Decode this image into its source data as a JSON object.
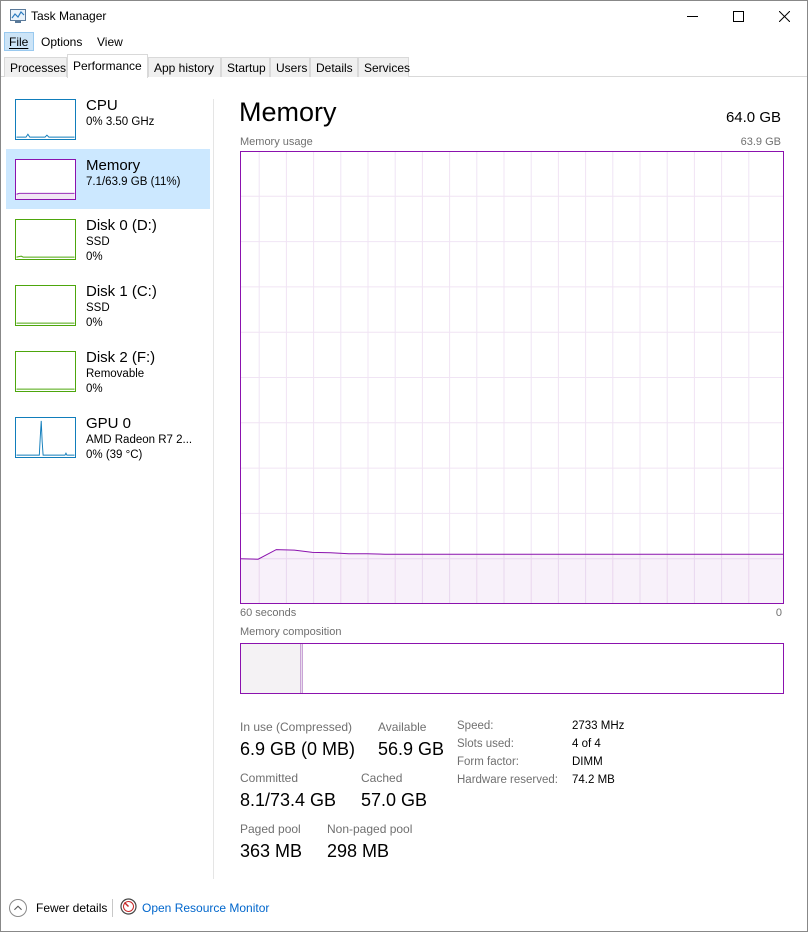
{
  "window": {
    "title": "Task Manager"
  },
  "menu": {
    "file": "File",
    "options": "Options",
    "view": "View"
  },
  "tabs": [
    {
      "label": "Processes"
    },
    {
      "label": "Performance"
    },
    {
      "label": "App history"
    },
    {
      "label": "Startup"
    },
    {
      "label": "Users"
    },
    {
      "label": "Details"
    },
    {
      "label": "Services"
    }
  ],
  "sidebar": [
    {
      "title": "CPU",
      "line1": "0%  3.50 GHz",
      "line2": ""
    },
    {
      "title": "Memory",
      "line1": "7.1/63.9 GB (11%)",
      "line2": ""
    },
    {
      "title": "Disk 0 (D:)",
      "line1": "SSD",
      "line2": "0%"
    },
    {
      "title": "Disk 1 (C:)",
      "line1": "SSD",
      "line2": "0%"
    },
    {
      "title": "Disk 2 (F:)",
      "line1": "Removable",
      "line2": "0%"
    },
    {
      "title": "GPU 0",
      "line1": "AMD Radeon R7 2...",
      "line2": "0%  (39 °C)"
    }
  ],
  "main": {
    "title": "Memory",
    "total": "64.0 GB",
    "usage_label": "Memory usage",
    "usage_max": "63.9 GB",
    "time_left": "60 seconds",
    "time_right": "0",
    "composition_label": "Memory composition"
  },
  "stats": {
    "in_use_label": "In use (Compressed)",
    "in_use_value": "6.9 GB (0 MB)",
    "available_label": "Available",
    "available_value": "56.9 GB",
    "committed_label": "Committed",
    "committed_value": "8.1/73.4 GB",
    "cached_label": "Cached",
    "cached_value": "57.0 GB",
    "paged_label": "Paged pool",
    "paged_value": "363 MB",
    "nonpaged_label": "Non-paged pool",
    "nonpaged_value": "298 MB"
  },
  "specs": {
    "speed_label": "Speed:",
    "speed_value": "2733 MHz",
    "slots_label": "Slots used:",
    "slots_value": "4 of 4",
    "form_label": "Form factor:",
    "form_value": "DIMM",
    "reserved_label": "Hardware reserved:",
    "reserved_value": "74.2 MB"
  },
  "footer": {
    "fewer": "Fewer details",
    "resmon": "Open Resource Monitor"
  },
  "colors": {
    "memory": "#8b12ae",
    "cpu": "#117dbb",
    "disk": "#4da60c",
    "gpu": "#117dbb",
    "selected": "#cce8ff"
  },
  "icons": {
    "app": "task-manager-icon",
    "minimize": "minimize-icon",
    "maximize": "maximize-icon",
    "close": "close-icon",
    "fewer": "chevron-up-icon",
    "resmon": "resource-monitor-icon"
  },
  "chart_data": {
    "type": "area",
    "x": [
      60,
      58,
      56,
      54,
      52,
      50,
      48,
      46,
      44,
      42,
      40,
      38,
      36,
      34,
      32,
      30,
      28,
      26,
      24,
      22,
      20,
      18,
      16,
      14,
      12,
      10,
      8,
      6,
      4,
      2,
      0
    ],
    "values": [
      10.0,
      9.9,
      12.0,
      11.9,
      11.4,
      11.3,
      11.1,
      11.1,
      11.0,
      11.0,
      11.0,
      11.0,
      11.0,
      11.0,
      11.0,
      11.0,
      11.0,
      11.0,
      11.0,
      11.0,
      11.0,
      11.0,
      11.0,
      11.0,
      11.0,
      11.0,
      11.0,
      11.0,
      11.0,
      11.0,
      11.0
    ],
    "ylim": [
      0,
      100
    ],
    "xlim": [
      60,
      0
    ],
    "grid": true
  }
}
